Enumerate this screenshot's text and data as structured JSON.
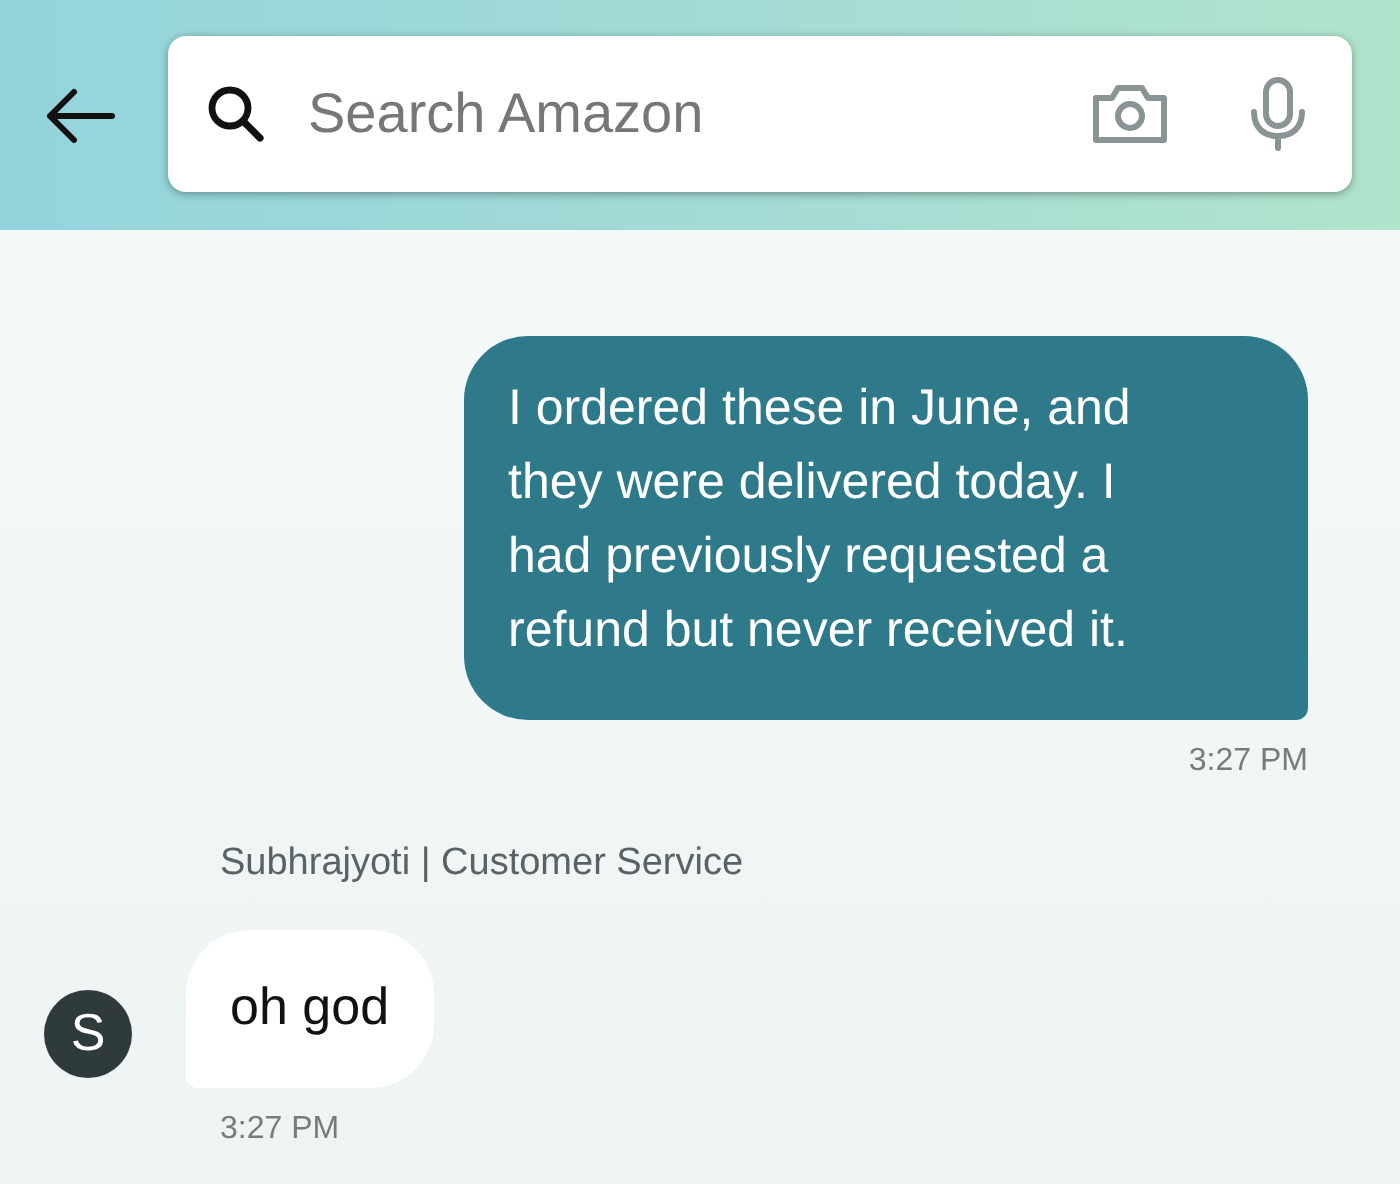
{
  "search": {
    "placeholder": "Search Amazon"
  },
  "messages": [
    {
      "kind": "outgoing",
      "text": "I ordered these in June, and they were delivered today. I had previously requested a refund but never received it.",
      "time": "3:27 PM"
    },
    {
      "kind": "incoming",
      "sender": "Subhrajyoti | Customer Service",
      "avatar": "S",
      "text": "oh god",
      "time": "3:27 PM"
    }
  ]
}
